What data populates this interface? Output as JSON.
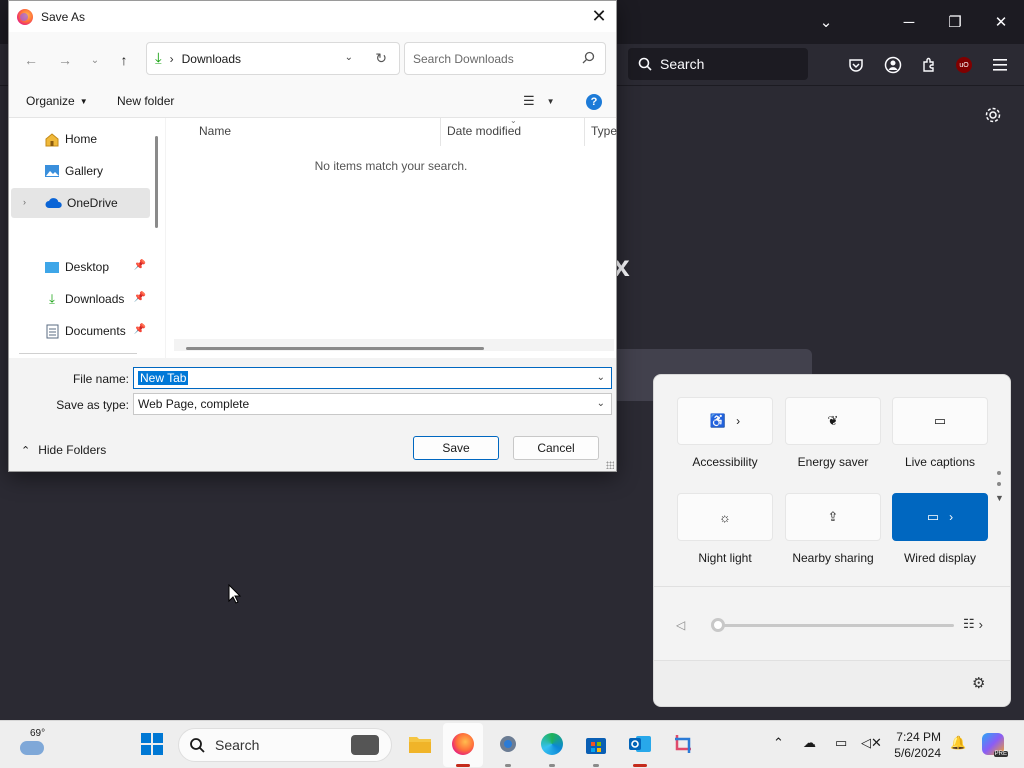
{
  "dialog": {
    "title": "Save As",
    "address": {
      "crumb": "Downloads"
    },
    "search": {
      "placeholder": "Search Downloads"
    },
    "commands": {
      "organize": "Organize",
      "new_folder": "New folder"
    },
    "nav": [
      {
        "label": "Home",
        "icon": "home-icon"
      },
      {
        "label": "Gallery",
        "icon": "gallery-icon"
      },
      {
        "label": "OneDrive",
        "icon": "onedrive-icon",
        "selected": true
      },
      {
        "label": "Desktop",
        "icon": "desktop-icon",
        "pinned": true
      },
      {
        "label": "Downloads",
        "icon": "download-icon",
        "pinned": true
      },
      {
        "label": "Documents",
        "icon": "documents-icon",
        "pinned": true
      }
    ],
    "columns": [
      "Name",
      "Date modified",
      "Type"
    ],
    "empty_message": "No items match your search.",
    "file_name_label": "File name:",
    "file_name_value": "New Tab",
    "save_type_label": "Save as type:",
    "save_type_value": "Web Page, complete",
    "hide_folders": "Hide Folders",
    "save_button": "Save",
    "cancel_button": "Cancel"
  },
  "firefox": {
    "search_label": "Search"
  },
  "quick_settings": {
    "tiles": [
      {
        "label": "Accessibility",
        "icon": "accessibility-icon",
        "active": false
      },
      {
        "label": "Energy saver",
        "icon": "energy-saver-icon",
        "active": false
      },
      {
        "label": "Live captions",
        "icon": "captions-icon",
        "active": false
      },
      {
        "label": "Night light",
        "icon": "night-light-icon",
        "active": false
      },
      {
        "label": "Nearby sharing",
        "icon": "share-icon",
        "active": false
      },
      {
        "label": "Wired display",
        "icon": "cast-icon",
        "active": true
      }
    ],
    "volume_level": 0
  },
  "taskbar": {
    "temperature": "69°",
    "search_label": "Search",
    "time": "7:24 PM",
    "date": "5/6/2024",
    "copilot_badge": "PRE"
  },
  "colors": {
    "accent": "#0067c0",
    "firefox_bg": "#2b2a33"
  }
}
